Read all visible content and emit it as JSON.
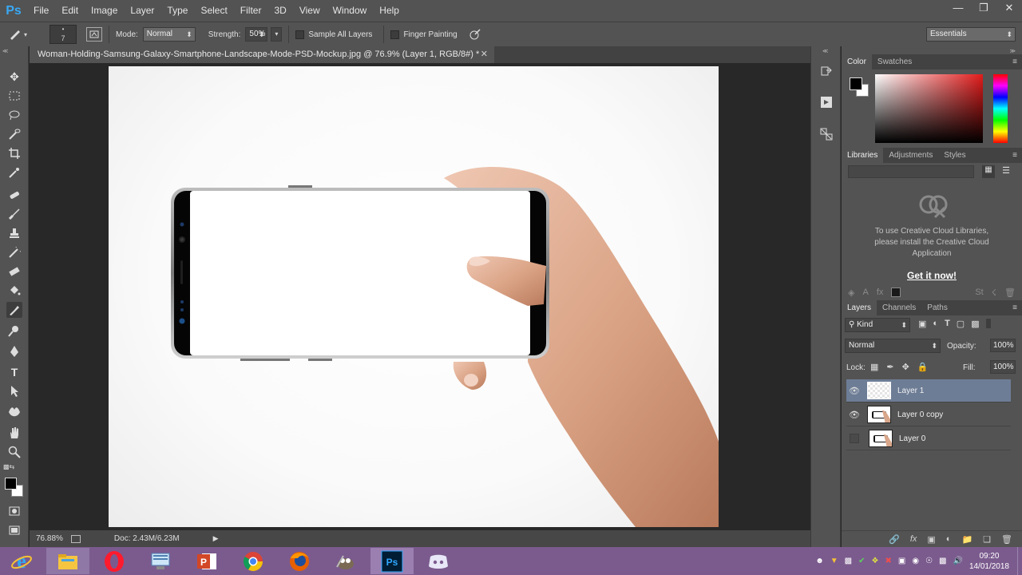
{
  "app": {
    "logo": "Ps"
  },
  "menu": [
    "File",
    "Edit",
    "Image",
    "Layer",
    "Type",
    "Select",
    "Filter",
    "3D",
    "View",
    "Window",
    "Help"
  ],
  "window_controls": [
    "minimize-icon",
    "restore-icon",
    "close-icon"
  ],
  "options": {
    "brush_size": "7",
    "mode_label": "Mode:",
    "mode_value": "Normal",
    "strength_label": "Strength:",
    "strength_value": "50%",
    "sample_all_layers": "Sample All Layers",
    "finger_painting": "Finger Painting",
    "workspace": "Essentials"
  },
  "document": {
    "tab_title": "Woman-Holding-Samsung-Galaxy-Smartphone-Landscape-Mode-PSD-Mockup.jpg @ 76.9% (Layer 1, RGB/8#) *",
    "zoom": "76.88%",
    "doc_size": "Doc: 2.43M/6.23M"
  },
  "color_panel": {
    "tabs": [
      "Color",
      "Swatches"
    ],
    "active": "Color"
  },
  "libraries_panel": {
    "tabs": [
      "Libraries",
      "Adjustments",
      "Styles"
    ],
    "message": "To use Creative Cloud Libraries, please install the Creative Cloud Application",
    "cta": "Get it now!"
  },
  "layers_panel": {
    "tabs": [
      "Layers",
      "Channels",
      "Paths"
    ],
    "filter": "Kind",
    "blend_mode": "Normal",
    "opacity_label": "Opacity:",
    "opacity_value": "100%",
    "lock_label": "Lock:",
    "fill_label": "Fill:",
    "fill_value": "100%",
    "layers": [
      {
        "name": "Layer 1",
        "visible": true,
        "selected": true
      },
      {
        "name": "Layer 0 copy",
        "visible": true,
        "selected": false
      },
      {
        "name": "Layer 0",
        "visible": false,
        "selected": false
      }
    ]
  },
  "taskbar": {
    "apps": [
      "internet-explorer",
      "file-explorer",
      "opera",
      "network-app",
      "powerpoint",
      "chrome",
      "firefox",
      "gimp",
      "photoshop",
      "discord"
    ],
    "time": "09:20",
    "date": "14/01/2018"
  },
  "colors": {
    "accent": "#39a9f5",
    "panel": "#535353",
    "selected_layer": "#6d7d96",
    "taskbar": "#7b5b8e"
  }
}
